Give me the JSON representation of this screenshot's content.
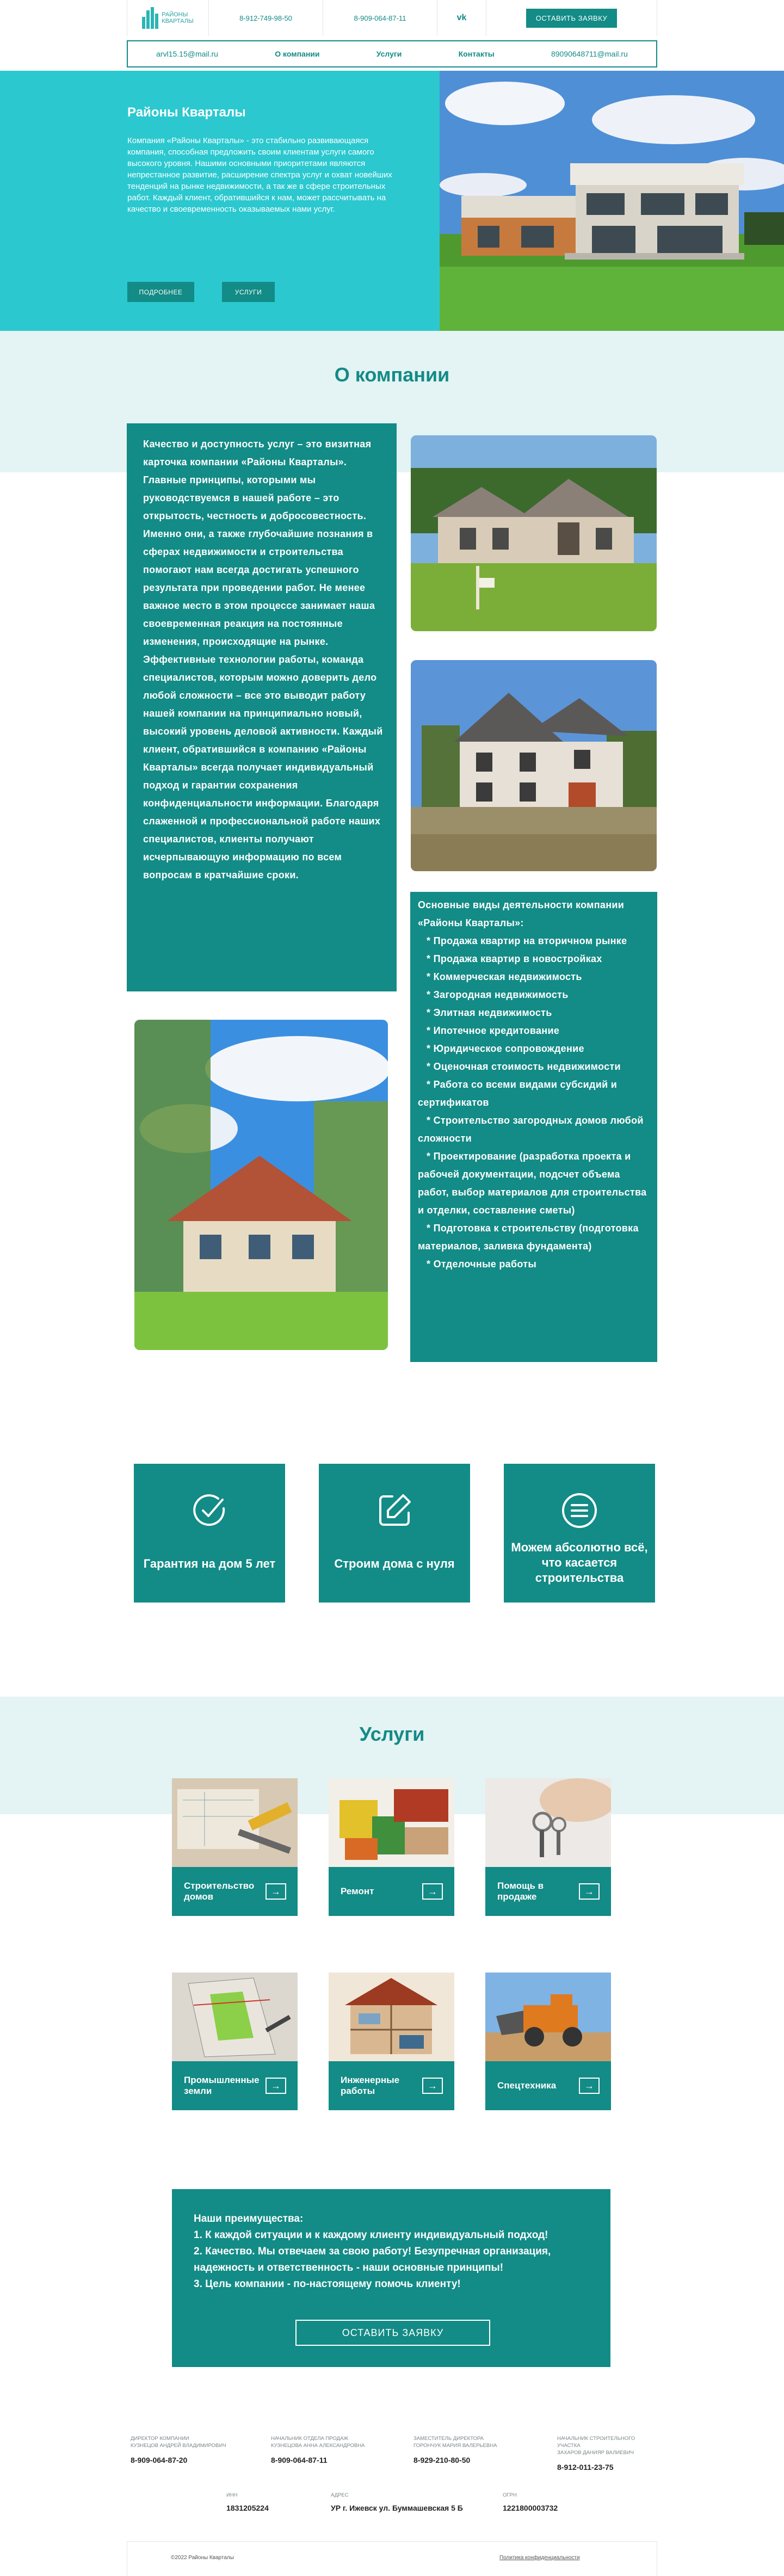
{
  "header": {
    "logo_text_1": "РАЙОНЫ",
    "logo_text_2": "КВАРТАЛЫ",
    "phone_1": "8-912-749-98-50",
    "phone_2": "8-909-064-87-11",
    "vk_label": "vk",
    "cta_label": "ОСТАВИТЬ ЗАЯВКУ"
  },
  "nav": {
    "email_left": "arvl15.15@mail.ru",
    "items": [
      "О компании",
      "Услуги",
      "Контакты"
    ],
    "email_right": "89090648711@mail.ru"
  },
  "hero": {
    "title": "Районы Кварталы",
    "text": "Компания «Районы Кварталы» - это стабильно развивающаяся компания, способная предложить своим клиентам услуги самого высокого уровня. Нашими основными приоритетами являются непрестанное развитие, расширение спектра услуг и охват новейших тенденций на рынке недвижимости, а так же в сфере строительных работ. Каждый клиент, обратившийся к нам, может рассчитывать на качество и своевременность оказываемых нами услуг.",
    "btn_more": "ПОДРОБНЕЕ",
    "btn_services": "УСЛУГИ"
  },
  "about": {
    "title": "О компании",
    "text": "Качество и доступность услуг – это визитная карточка компании «Районы Кварталы». Главные принципы, которыми мы руководствуемся в нашей работе – это открытость, честность и добросовестность. Именно они, а также глубочайшие познания в сферах недвижимости и строительства помогают нам всегда достигать успешного результата при проведении работ. Не менее важное место в этом процессе занимает наша своевременная реакция на постоянные изменения, происходящие на рынке. Эффективные технологии работы, команда специалистов, которым можно доверить дело любой сложности – все это выводит работу нашей компании на принципиально новый, высокий уровень деловой активности. Каждый клиент, обратившийся в компанию «Районы Кварталы» всегда получает индивидуальный подход и гарантии сохранения конфиденциальности информации. Благодаря слаженной и профессиональной работе наших специалистов, клиенты получают исчерпывающую информацию по всем вопросам в кратчайшие сроки.",
    "list_title": "Основные виды деятельности компании «Районы Кварталы»:",
    "list": [
      "Продажа квартир на вторичном рынке",
      "Продажа квартир в новостройках",
      "Коммерческая недвижимость",
      "Загородная недвижимость",
      "Элитная недвижимость",
      "Ипотечное кредитование",
      "Юридическое сопровождение",
      "Оценочная стоимость недвижимости",
      "Работа со всеми видами субсидий и сертификатов",
      "Строительство загородных домов любой сложности",
      "Проектирование (разработка проекта и рабочей документации, подсчет объема работ, выбор материалов для строительства и отделки, составление сметы)",
      "Подготовка к строительству (подготовка материалов, заливка фундамента)",
      "Отделочные работы"
    ]
  },
  "features": [
    {
      "title": "Гарантия на дом 5 лет",
      "icon": "check-circle-icon"
    },
    {
      "title": "Строим дома с нуля",
      "icon": "edit-icon"
    },
    {
      "title": "Можем абсолютно всё, что касается строительства",
      "icon": "menu-circle-icon"
    }
  ],
  "services": {
    "title": "Услуги",
    "items": [
      {
        "label": "Строительство домов"
      },
      {
        "label": "Ремонт"
      },
      {
        "label": "Помощь в продаже"
      },
      {
        "label": "Промышленные земли"
      },
      {
        "label": "Инженерные работы"
      },
      {
        "label": "Спецтехника"
      }
    ],
    "arrow": "→"
  },
  "advantages": {
    "lines": [
      "Наши преимущества:",
      "1. К каждой ситуации и к каждому клиенту индивидуальный подход!",
      "2. Качество. Мы отвечаем за свою работу! Безупречная организация, надежность и ответственность - наши основные принципы!",
      "3. Цель компании - по-настоящему помочь клиенту!"
    ],
    "button": "ОСТАВИТЬ ЗАЯВКУ"
  },
  "footer": {
    "contacts": [
      {
        "role": "ДИРЕКТОР КОМПАНИИ",
        "name": "КУЗНЕЦОВ АНДРЕЙ ВЛАДИМИРОВИЧ",
        "phone": "8-909-064-87-20"
      },
      {
        "role": "НАЧАЛЬНИК ОТДЕЛА ПРОДАЖ",
        "name": "КУЗНЕЦОВА АННА АЛЕКСАНДРОВНА",
        "phone": "8-909-064-87-11"
      },
      {
        "role": "ЗАМЕСТИТЕЛЬ ДИРЕКТОРА",
        "name": "ГОРОНЧУК МАРИЯ ВАЛЕРЬЕВНА",
        "phone": "8-929-210-80-50"
      },
      {
        "role": "НАЧАЛЬНИК СТРОИТЕЛЬНОГО УЧАСТКА",
        "name": "ЗАХАРОВ ДАНИЯР ВАЛИЕВИЧ",
        "phone": "8-912-011-23-75"
      }
    ],
    "requisites": [
      {
        "label": "ИНН",
        "value": "1831205224"
      },
      {
        "label": "АДРЕС",
        "value": "УР г. Ижевск ул. Буммашевская 5 Б"
      },
      {
        "label": "ОГРН",
        "value": "1221800003732"
      }
    ],
    "copyright": "©2022 Районы Кварталы",
    "policy": "Политика конфиденциальности"
  },
  "colors": {
    "teal": "#138b86",
    "hero_bg": "#2bc8cf",
    "band": "#e4f3f3"
  }
}
